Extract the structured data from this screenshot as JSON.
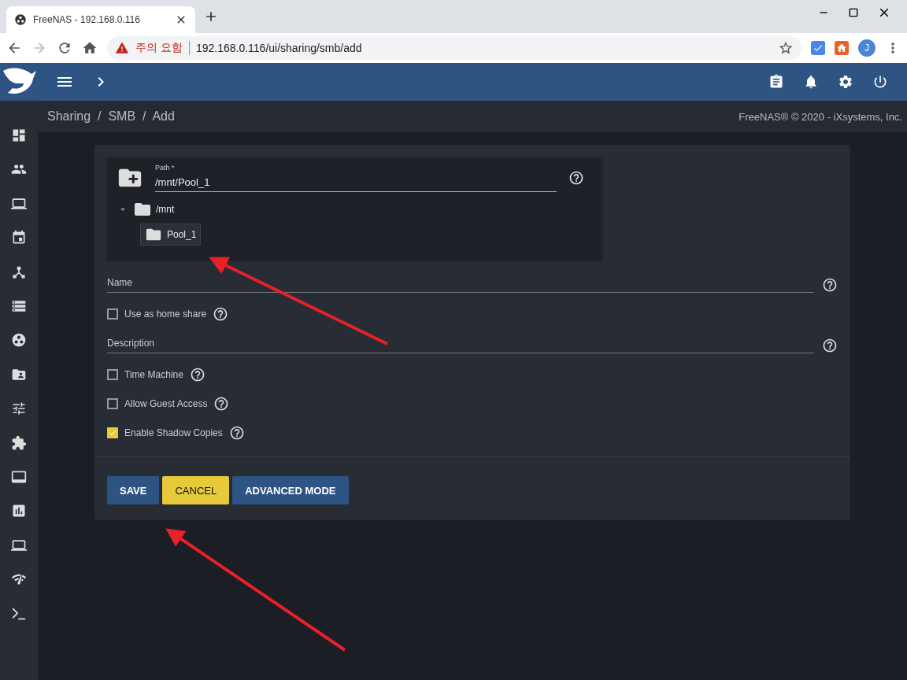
{
  "browser": {
    "tab_title": "FreeNAS - 192.168.0.116",
    "security_label": "주의 요함",
    "url": "192.168.0.116/ui/sharing/smb/add",
    "avatar": "J",
    "forward_disabled": true
  },
  "breadcrumb": "Sharing  /  SMB  /  Add",
  "copyright": "FreeNAS® © 2020 - iXsystems, Inc.",
  "path": {
    "label": "Path *",
    "value": "/mnt/Pool_1"
  },
  "tree": [
    {
      "label": "/mnt",
      "expanded": true,
      "selected": false,
      "children": [
        {
          "label": "Pool_1",
          "selected": true
        }
      ]
    }
  ],
  "fields": [
    {
      "kind": "text",
      "label": "Name"
    },
    {
      "kind": "checkbox",
      "label": "Use as home share",
      "checked": false
    },
    {
      "kind": "text",
      "label": "Description"
    },
    {
      "kind": "checkbox",
      "label": "Time Machine",
      "checked": false
    },
    {
      "kind": "checkbox",
      "label": "Allow Guest Access",
      "checked": false
    },
    {
      "kind": "checkbox",
      "label": "Enable Shadow Copies",
      "checked": true
    }
  ],
  "buttons": [
    {
      "label": "SAVE",
      "kind": "primary"
    },
    {
      "label": "CANCEL",
      "kind": "accent"
    },
    {
      "label": "ADVANCED MODE",
      "kind": "primary"
    }
  ]
}
